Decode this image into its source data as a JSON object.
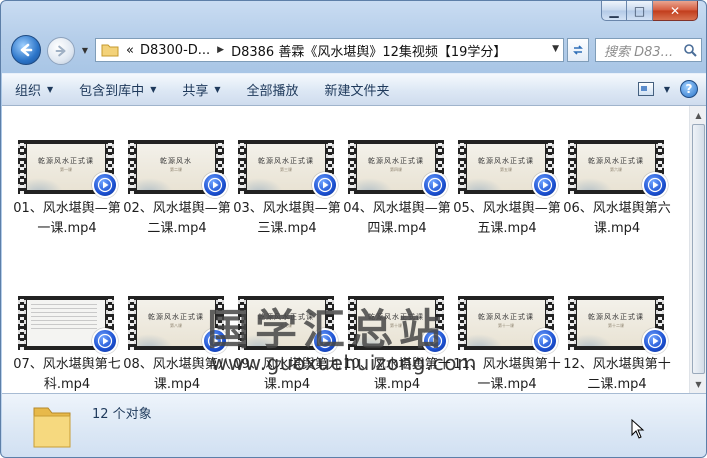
{
  "window": {
    "caption_buttons": {
      "minimize": "▁",
      "maximize": "□",
      "close": "✕"
    }
  },
  "nav": {
    "address_overflow": "«",
    "address_segments": [
      "D8300-D...",
      "D8386 善霖《风水堪舆》12集视频【19学分】"
    ],
    "search_placeholder": "搜索 D83..."
  },
  "toolbar": {
    "items": [
      "组织",
      "包含到库中",
      "共享",
      "全部播放",
      "新建文件夹"
    ]
  },
  "files": [
    {
      "name": "01、风水堪舆—第一课.mp4",
      "slide_title": "乾源风水正式课",
      "slide_sub": "第一课"
    },
    {
      "name": "02、风水堪舆—第二课.mp4",
      "slide_title": "乾源风水",
      "slide_sub": "第二课"
    },
    {
      "name": "03、风水堪舆—第三课.mp4",
      "slide_title": "乾源风水正式课",
      "slide_sub": "第三课"
    },
    {
      "name": "04、风水堪舆—第四课.mp4",
      "slide_title": "乾源风水正式课",
      "slide_sub": "第四课"
    },
    {
      "name": "05、风水堪舆—第五课.mp4",
      "slide_title": "乾源风水正式课",
      "slide_sub": "第五课"
    },
    {
      "name": "06、风水堪舆第六课.mp4",
      "slide_title": "乾源风水正式课",
      "slide_sub": "第六课"
    },
    {
      "name": "07、风水堪舆第七科.mp4",
      "slide_title": "",
      "slide_sub": ""
    },
    {
      "name": "08、风水堪舆第八课.mp4",
      "slide_title": "乾源风水正式课",
      "slide_sub": "第八课"
    },
    {
      "name": "09、风水堪舆第九课.mp4",
      "slide_title": "乾源风水正式课",
      "slide_sub": "第九课"
    },
    {
      "name": "10、风水堪舆第十课.mp4",
      "slide_title": "乾源风水正式课",
      "slide_sub": "第十课"
    },
    {
      "name": "11、风水堪舆第十一课.mp4",
      "slide_title": "乾源风水正式课",
      "slide_sub": "第十一课"
    },
    {
      "name": "12、风水堪舆第十二课.mp4",
      "slide_title": "乾源风水正式课",
      "slide_sub": "第十二课"
    }
  ],
  "watermark": {
    "text": "国学汇总站",
    "url": "www.guoxuehuizong.com"
  },
  "details": {
    "count_text": "12 个对象"
  },
  "colors": {
    "accent": "#2b74c8",
    "command_text": "#1e395b"
  }
}
